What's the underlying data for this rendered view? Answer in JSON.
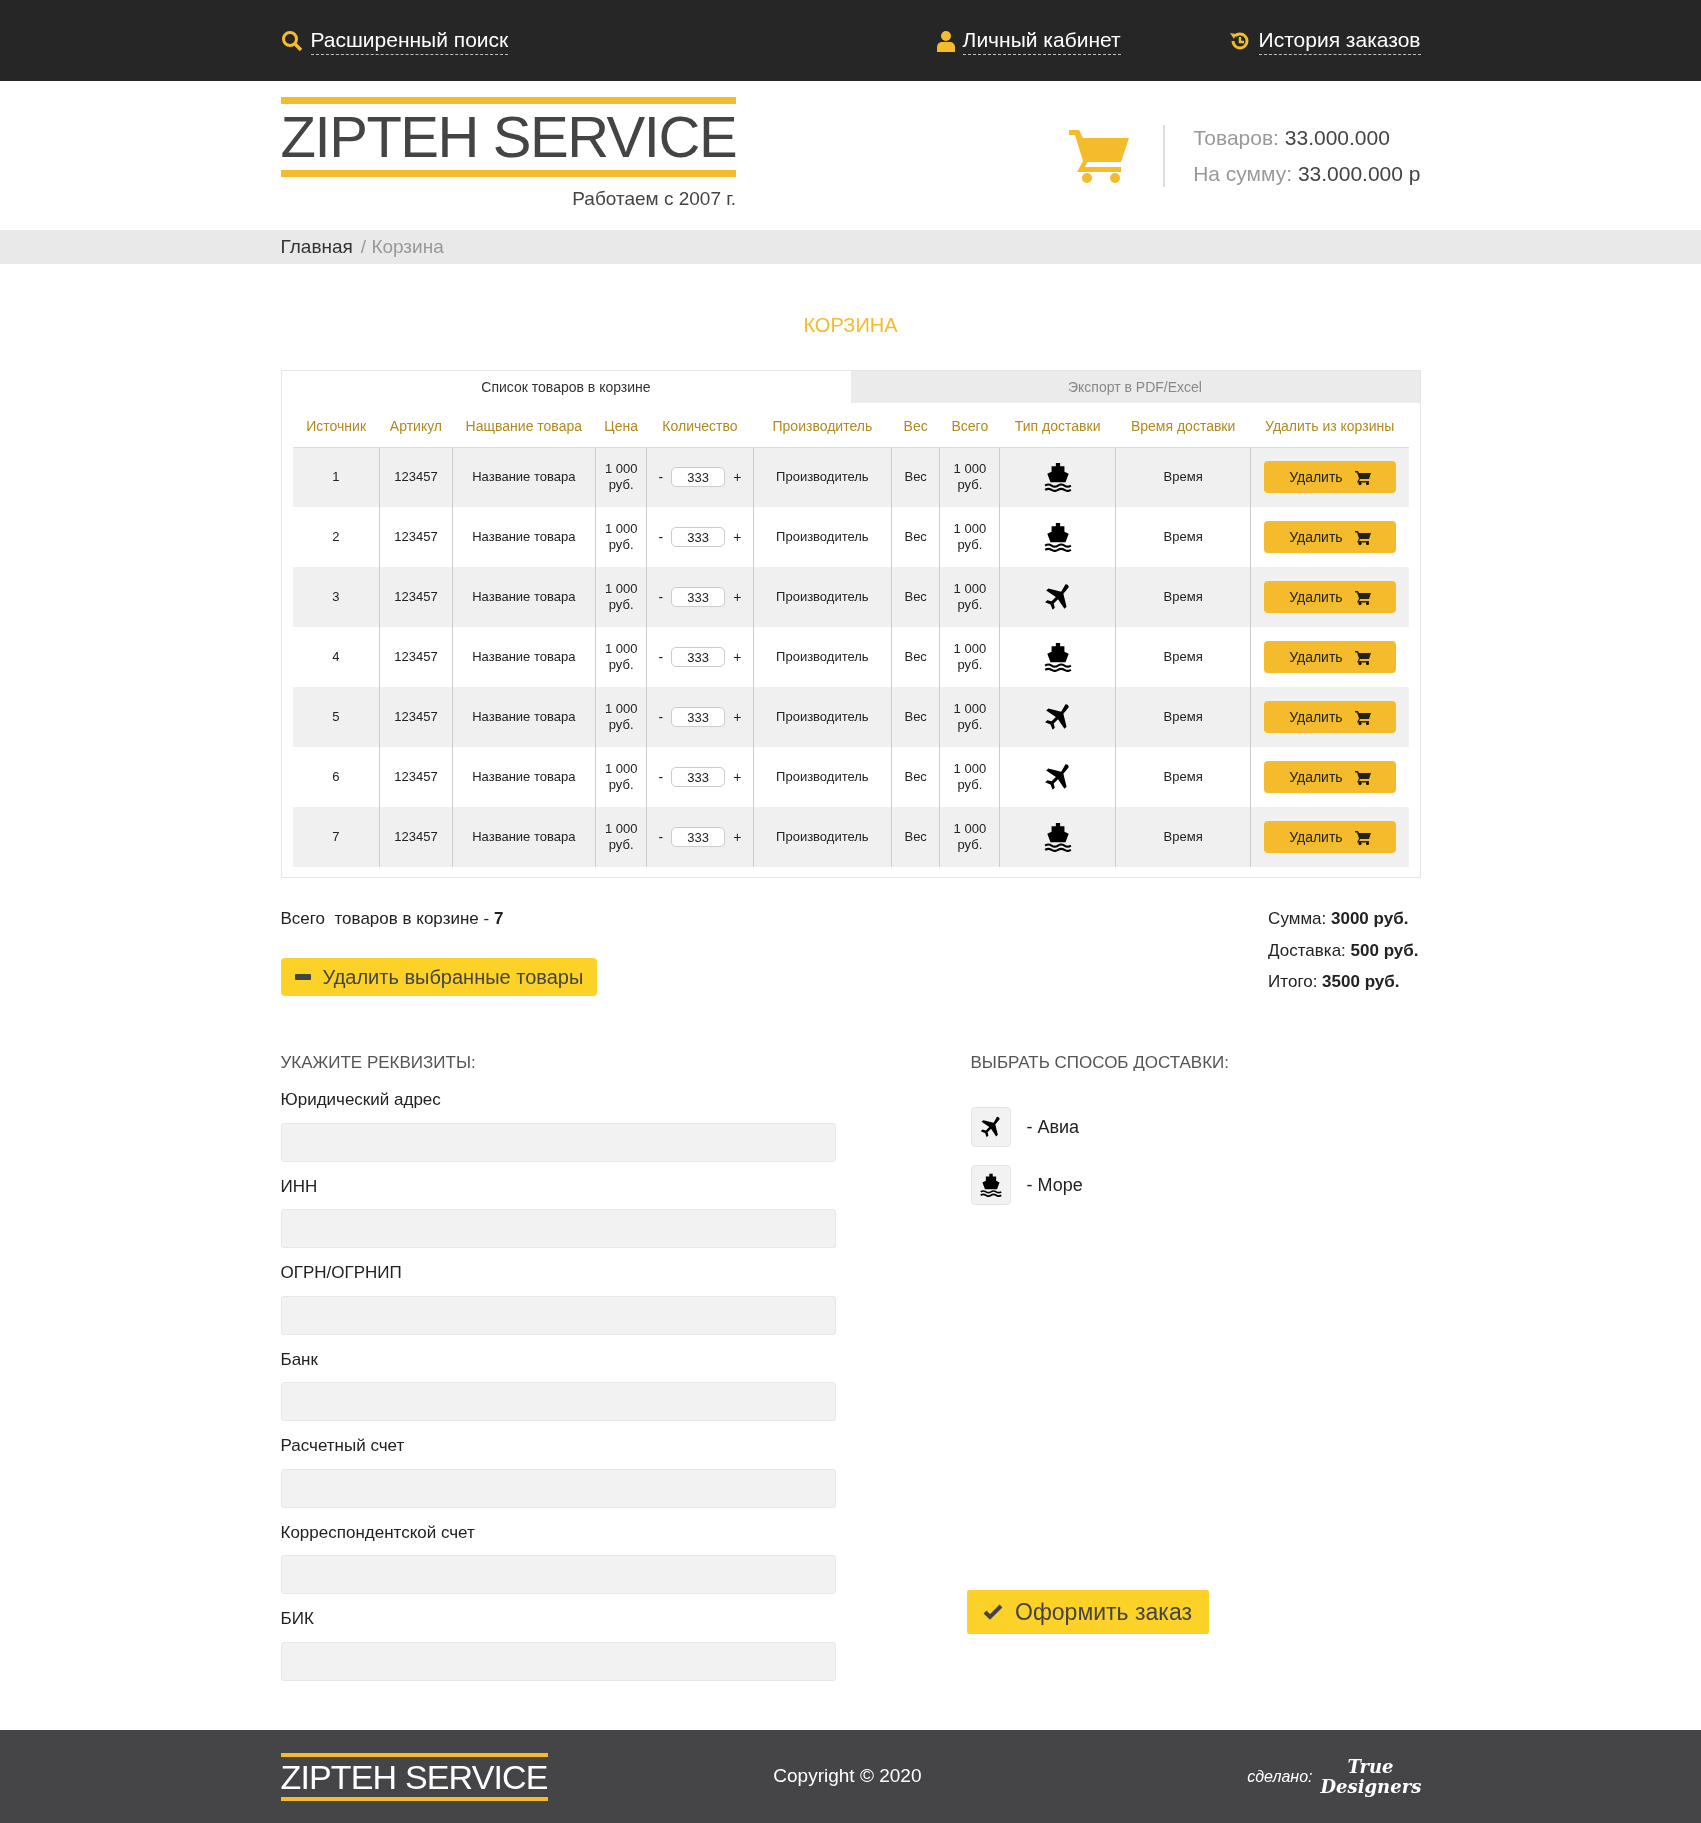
{
  "top_nav": [
    {
      "kind": "search",
      "label": "Расширенный поиск"
    },
    {
      "kind": "user",
      "label": "Личный кабинет"
    },
    {
      "kind": "history",
      "label": "История заказов"
    }
  ],
  "logo": {
    "text": "ZIPTEH SERVICE",
    "tagline": "Работаем с 2007 г."
  },
  "cart_summary": {
    "items_label": "Товаров:",
    "items_value": "33.000.000",
    "sum_label": "На сумму:",
    "sum_value": "33.000.000 р"
  },
  "breadcrumb": [
    {
      "label": "Главная",
      "current": false
    },
    {
      "label": "/ Корзина",
      "current": true
    }
  ],
  "page_title": "КОРЗИНА",
  "tabs": [
    {
      "label": "Список товаров в корзине",
      "selected": true
    },
    {
      "label": "Экспорт в PDF/Excel",
      "selected": false
    }
  ],
  "table": {
    "columns": [
      "Источник",
      "Артикул",
      "Нащвание товара",
      "Цена",
      "Количество",
      "Производитель",
      "Вес",
      "Всего",
      "Тип доставки",
      "Время доставки",
      "Удалить из корзины"
    ],
    "rows": [
      {
        "source": "1",
        "sku": "123457",
        "name": "Название товара",
        "price": "1 000 руб.",
        "minus": "-",
        "qty": "333",
        "plus": "+",
        "maker": "Производитель",
        "weight": "Вес",
        "total": "1 000 руб.",
        "delivery": {
          "kind": "sea"
        },
        "time": "Время",
        "delete": "Удалить"
      },
      {
        "source": "2",
        "sku": "123457",
        "name": "Название товара",
        "price": "1 000 руб.",
        "minus": "-",
        "qty": "333",
        "plus": "+",
        "maker": "Производитель",
        "weight": "Вес",
        "total": "1 000 руб.",
        "delivery": {
          "kind": "sea"
        },
        "time": "Время",
        "delete": "Удалить"
      },
      {
        "source": "3",
        "sku": "123457",
        "name": "Название товара",
        "price": "1 000 руб.",
        "minus": "-",
        "qty": "333",
        "plus": "+",
        "maker": "Производитель",
        "weight": "Вес",
        "total": "1 000 руб.",
        "delivery": {
          "kind": "air"
        },
        "time": "Время",
        "delete": "Удалить"
      },
      {
        "source": "4",
        "sku": "123457",
        "name": "Название товара",
        "price": "1 000 руб.",
        "minus": "-",
        "qty": "333",
        "plus": "+",
        "maker": "Производитель",
        "weight": "Вес",
        "total": "1 000 руб.",
        "delivery": {
          "kind": "sea"
        },
        "time": "Время",
        "delete": "Удалить"
      },
      {
        "source": "5",
        "sku": "123457",
        "name": "Название товара",
        "price": "1 000 руб.",
        "minus": "-",
        "qty": "333",
        "plus": "+",
        "maker": "Производитель",
        "weight": "Вес",
        "total": "1 000 руб.",
        "delivery": {
          "kind": "air"
        },
        "time": "Время",
        "delete": "Удалить"
      },
      {
        "source": "6",
        "sku": "123457",
        "name": "Название товара",
        "price": "1 000 руб.",
        "minus": "-",
        "qty": "333",
        "plus": "+",
        "maker": "Производитель",
        "weight": "Вес",
        "total": "1 000 руб.",
        "delivery": {
          "kind": "air"
        },
        "time": "Время",
        "delete": "Удалить"
      },
      {
        "source": "7",
        "sku": "123457",
        "name": "Название товара",
        "price": "1 000 руб.",
        "minus": "-",
        "qty": "333",
        "plus": "+",
        "maker": "Производитель",
        "weight": "Вес",
        "total": "1 000 руб.",
        "delivery": {
          "kind": "sea"
        },
        "time": "Время",
        "delete": "Удалить"
      }
    ]
  },
  "summary": {
    "count_text": "Всего  товаров в корзине - **7**",
    "totals": [
      "Сумма: **3000 руб.**",
      "Доставка: **500 руб.**",
      "Итого: **3500 руб.**"
    ]
  },
  "delete_selected": "Удалить выбранные товары",
  "requisites": {
    "title": "УКАЖИТЕ РЕКВИЗИТЫ:",
    "fields": [
      {
        "label": "Юридический адрес"
      },
      {
        "label": "ИНН"
      },
      {
        "label": "ОГРН/ОГРНИП"
      },
      {
        "label": "Банк"
      },
      {
        "label": "Расчетный счет"
      },
      {
        "label": "Корреспондентской счет"
      },
      {
        "label": "БИК"
      }
    ]
  },
  "delivery": {
    "title": "ВЫБРАТЬ СПОСОБ ДОСТАВКИ:",
    "options": [
      {
        "kind": "air",
        "label": "- Авиа"
      },
      {
        "kind": "sea",
        "label": "- Море"
      }
    ]
  },
  "submit": "Оформить заказ",
  "footer": {
    "logo": "ZIPTEH SERVICE",
    "copyright": "Copyright © 2020",
    "made_by_label": "сделано:",
    "made_by": "True Designers"
  }
}
